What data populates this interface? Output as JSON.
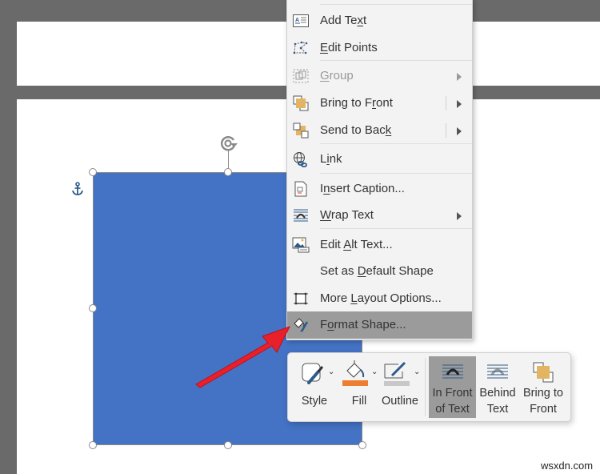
{
  "document": {
    "shape_color": "#4472c4",
    "page_bg": "#ffffff",
    "canvas_bg": "#6a6a6a"
  },
  "context_menu": {
    "items": [
      {
        "label_pre": "Add Te",
        "accel": "x",
        "label_post": "t",
        "icon": "add-text-icon",
        "disabled": false,
        "submenu": false
      },
      {
        "label_pre": "",
        "accel": "E",
        "label_post": "dit Points",
        "icon": "edit-points-icon",
        "disabled": false,
        "submenu": false
      },
      {
        "label_pre": "",
        "accel": "G",
        "label_post": "roup",
        "icon": "group-icon",
        "disabled": true,
        "submenu": true
      },
      {
        "label_pre": "Bring to F",
        "accel": "r",
        "label_post": "ont",
        "icon": "bring-to-front-icon",
        "disabled": false,
        "submenu": true
      },
      {
        "label_pre": "Send to Bac",
        "accel": "k",
        "label_post": "",
        "icon": "send-to-back-icon",
        "disabled": false,
        "submenu": true
      },
      {
        "label_pre": "L",
        "accel": "i",
        "label_post": "nk",
        "icon": "link-icon",
        "disabled": false,
        "submenu": false
      },
      {
        "label_pre": "I",
        "accel": "n",
        "label_post": "sert Caption...",
        "icon": "insert-caption-icon",
        "disabled": false,
        "submenu": false
      },
      {
        "label_pre": "",
        "accel": "W",
        "label_post": "rap Text",
        "icon": "wrap-text-icon",
        "disabled": false,
        "submenu": true
      },
      {
        "label_pre": "Edit ",
        "accel": "A",
        "label_post": "lt Text...",
        "icon": "alt-text-icon",
        "disabled": false,
        "submenu": false
      },
      {
        "label_pre": "Set as ",
        "accel": "D",
        "label_post": "efault Shape",
        "icon": "",
        "disabled": false,
        "submenu": false
      },
      {
        "label_pre": "More ",
        "accel": "L",
        "label_post": "ayout Options...",
        "icon": "layout-options-icon",
        "disabled": false,
        "submenu": false
      },
      {
        "label_pre": "F",
        "accel": "o",
        "label_post": "rmat Shape...",
        "icon": "format-shape-icon",
        "disabled": false,
        "submenu": false,
        "highlighted": true
      }
    ]
  },
  "mini_toolbar": {
    "style_label": "Style",
    "fill_label": "Fill",
    "outline_label": "Outline",
    "in_front_line1": "In Front",
    "in_front_line2": "of Text",
    "behind_line1": "Behind",
    "behind_line2": "Text",
    "bring_line1": "Bring to",
    "bring_line2": "Front",
    "fill_color": "#ed7d31",
    "outline_color": "#c8c8c8"
  },
  "watermark": "wsxdn.com"
}
